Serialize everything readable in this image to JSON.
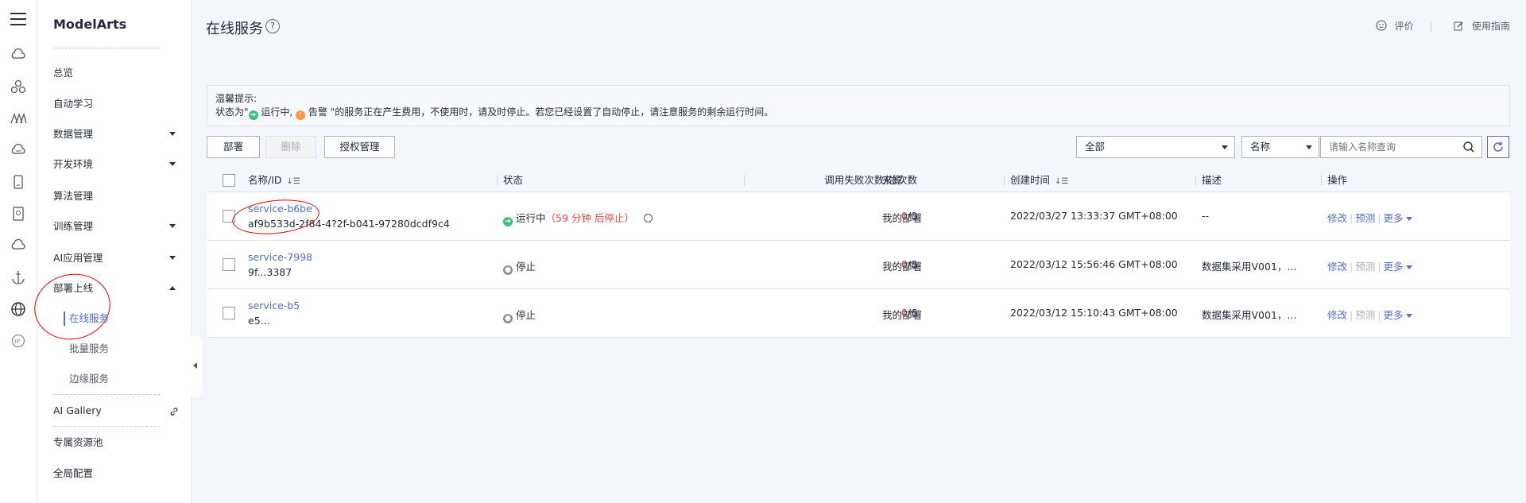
{
  "sidebar": {
    "brand": "ModelArts",
    "items": [
      {
        "label": "总览"
      },
      {
        "label": "自动学习"
      },
      {
        "label": "数据管理"
      },
      {
        "label": "开发环境"
      },
      {
        "label": "算法管理"
      },
      {
        "label": "训练管理"
      },
      {
        "label": "AI应用管理"
      },
      {
        "label": "部署上线"
      },
      {
        "label": "在线服务"
      },
      {
        "label": "批量服务"
      },
      {
        "label": "边缘服务"
      },
      {
        "label": "AI Gallery"
      },
      {
        "label": "专属资源池"
      },
      {
        "label": "全局配置"
      }
    ]
  },
  "header": {
    "title": "在线服务",
    "help": "?",
    "rate_label": "评价",
    "guide_label": "使用指南"
  },
  "tip": {
    "title": "温馨提示:",
    "line_prefix": "状态为\"",
    "running": "运行中,",
    "alarm": "告警",
    "line_suffix": "\"的服务正在产生费用，不使用时，请及时停止。若您已经设置了自动停止，请注意服务的剩余运行时间。"
  },
  "toolbar": {
    "deploy_label": "部署",
    "delete_label": "删除",
    "auth_label": "授权管理",
    "filter_value": "全部",
    "field_value": "名称",
    "search_placeholder": "请输入名称查询"
  },
  "table": {
    "columns": [
      "名称/ID",
      "状态",
      "调用失败次数/总次数",
      "来源",
      "创建时间",
      "描述",
      "操作"
    ],
    "rows": [
      {
        "name": "service-b6be",
        "id": "af9b533d-2f84-4?2f-b041-97280dcdf9c4",
        "status": "运行中",
        "status_extra": "（59 分钟 后停止）",
        "fail": "0",
        "total": "/0",
        "source": "我的部署",
        "created": "2022/03/27 13:33:37 GMT+08:00",
        "desc": "--",
        "op_modify": "修改",
        "op_predict": "预测",
        "op_more": "更多"
      },
      {
        "name": "service-7998",
        "id": "9f...3387",
        "status": "停止",
        "status_extra": "",
        "fail": "0",
        "total": "/8",
        "source": "我的部署",
        "created": "2022/03/12 15:56:46 GMT+08:00",
        "desc": "数据集采用V001，...",
        "op_modify": "修改",
        "op_predict": "预测",
        "op_more": "更多"
      },
      {
        "name": "service-b5",
        "id": "e5...",
        "status": "停止",
        "status_extra": "",
        "fail": "0",
        "total": "/6",
        "source": "我的部署",
        "created": "2022/03/12 15:10:43 GMT+08:00",
        "desc": "数据集采用V001，...",
        "op_modify": "修改",
        "op_predict": "预测",
        "op_more": "更多"
      }
    ]
  },
  "colors": {
    "accent": "#526ecc",
    "running": "#3cc37a",
    "alarm": "#fa9841",
    "stopped": "#8a8e99",
    "error": "#e54545"
  }
}
